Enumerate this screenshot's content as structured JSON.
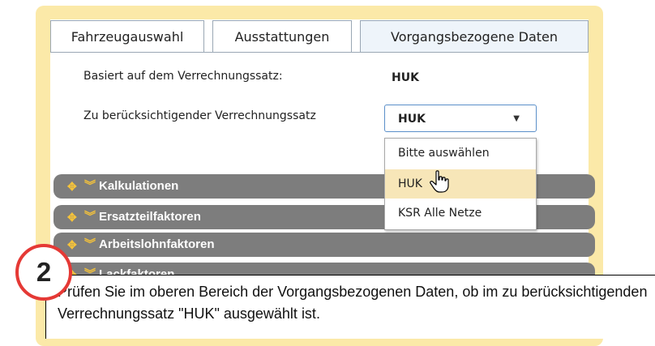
{
  "tabs": [
    {
      "label": "Fahrzeugauswahl"
    },
    {
      "label": "Ausstattungen"
    },
    {
      "label": "Vorgangsbezogene Daten",
      "active": true
    }
  ],
  "form": {
    "based_on_label": "Basiert auf dem Verrechnungssatz:",
    "based_on_value": "HUK",
    "rate_label": "Zu berücksichtigender Verrechnungssatz",
    "rate_selected": "HUK"
  },
  "dropdown": {
    "options": [
      {
        "label": "Bitte auswählen"
      },
      {
        "label": "HUK",
        "highlighted": true
      },
      {
        "label": "KSR Alle Netze"
      }
    ]
  },
  "sections": [
    {
      "label": "Kalkulationen"
    },
    {
      "label": "Ersatzteilfaktoren"
    },
    {
      "label": "Arbeitslohnfaktoren"
    },
    {
      "label": "Lackfaktoren"
    }
  ],
  "callout": {
    "step": "2",
    "text": "Prüfen Sie im oberen Bereich der Vorgangsbezogenen Daten, ob im zu berücksichtigenden Verrechnungssatz \"HUK\" ausgewählt ist."
  },
  "colors": {
    "frame": "#fbe9a8",
    "section_bar": "#7d7d7d",
    "icon_accent": "#f4c23b",
    "highlight": "#f7e6b8",
    "badge_border": "#e53935"
  }
}
